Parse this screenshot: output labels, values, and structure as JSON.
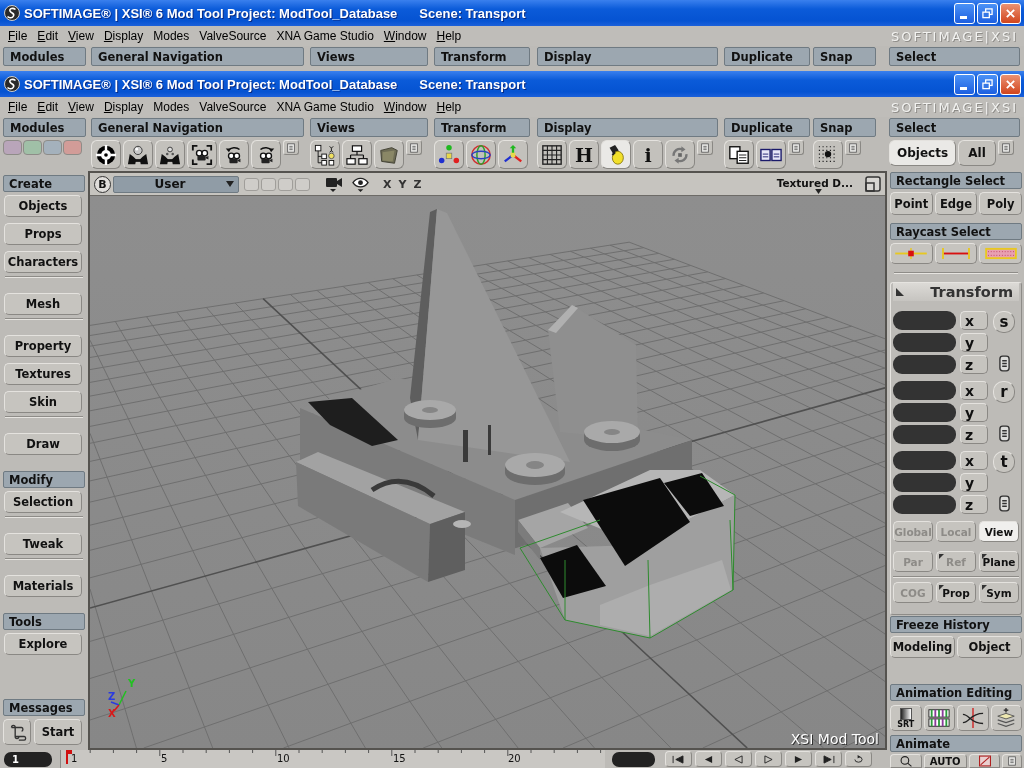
{
  "back_window": {
    "title": "SOFTIMAGE® | XSI® 6 Mod Tool Project: ModTool_Database",
    "scene": "Scene: Transport",
    "menu": [
      {
        "label": "File",
        "mnemonic": true
      },
      {
        "label": "Edit",
        "mnemonic": true
      },
      {
        "label": "View",
        "mnemonic": true
      },
      {
        "label": "Display",
        "mnemonic": true
      },
      {
        "label": "Modes",
        "mnemonic": false
      },
      {
        "label": "ValveSource",
        "mnemonic": false
      },
      {
        "label": "XNA Game Studio",
        "mnemonic": false
      },
      {
        "label": "Window",
        "mnemonic": true
      },
      {
        "label": "Help",
        "mnemonic": true
      }
    ],
    "logo": "SOFTIMAGE|XSI",
    "toolbar": [
      {
        "label": "Modules"
      },
      {
        "label": "General Navigation"
      },
      {
        "label": "Views"
      },
      {
        "label": "Transform"
      },
      {
        "label": "Display"
      },
      {
        "label": "Duplicate"
      },
      {
        "label": "Snap"
      },
      {
        "label": "Select"
      }
    ]
  },
  "window": {
    "title": "SOFTIMAGE® | XSI® 6 Mod Tool Project: ModTool_Database",
    "scene": "Scene: Transport",
    "menu": [
      {
        "label": "File",
        "mnemonic": true
      },
      {
        "label": "Edit",
        "mnemonic": true
      },
      {
        "label": "View",
        "mnemonic": true
      },
      {
        "label": "Display",
        "mnemonic": true
      },
      {
        "label": "Modes",
        "mnemonic": false
      },
      {
        "label": "ValveSource",
        "mnemonic": false
      },
      {
        "label": "XNA Game Studio",
        "mnemonic": false
      },
      {
        "label": "Window",
        "mnemonic": true
      },
      {
        "label": "Help",
        "mnemonic": true
      }
    ],
    "logo": "SOFTIMAGE|XSI",
    "toolbar": [
      {
        "label": "Modules",
        "swatches": [
          {
            "color": "#b9a5ba"
          },
          {
            "color": "#a0c0a7"
          },
          {
            "color": "#a4b1bc"
          },
          {
            "color": "#d29c98"
          }
        ]
      },
      {
        "label": "General Navigation",
        "tools": [
          {
            "kind": "icon",
            "active": false
          },
          {
            "kind": "icon",
            "active": false
          },
          {
            "kind": "icon",
            "active": false
          },
          {
            "kind": "icon",
            "active": false
          },
          {
            "kind": "icon",
            "active": false
          },
          {
            "kind": "icon",
            "active": false
          },
          {
            "kind": "menu",
            "active": false
          }
        ]
      },
      {
        "label": "Views",
        "tools": [
          {
            "kind": "icon",
            "active": false
          },
          {
            "kind": "icon",
            "active": false
          },
          {
            "kind": "icon",
            "active": false
          },
          {
            "kind": "menu",
            "active": false
          }
        ]
      },
      {
        "label": "Transform",
        "tools": [
          {
            "kind": "icon",
            "active": false
          },
          {
            "kind": "icon",
            "active": false
          },
          {
            "kind": "icon",
            "active": false
          }
        ]
      },
      {
        "label": "Display",
        "tools": [
          {
            "kind": "icon",
            "active": false
          },
          {
            "kind": "glyph",
            "label": "H",
            "active": false
          },
          {
            "kind": "icon",
            "active": true
          },
          {
            "kind": "glyph",
            "label": "i",
            "active": false
          },
          {
            "kind": "icon",
            "active": false
          },
          {
            "kind": "menu",
            "active": false
          }
        ]
      },
      {
        "label": "Duplicate",
        "tools": [
          {
            "kind": "icon",
            "active": false
          },
          {
            "kind": "icon",
            "active": false
          },
          {
            "kind": "menu",
            "active": false
          }
        ]
      },
      {
        "label": "Snap",
        "tools": [
          {
            "kind": "icon",
            "active": false
          },
          {
            "kind": "menu",
            "active": false
          }
        ]
      },
      {
        "label": "Select",
        "tools": [
          {
            "kind": "text",
            "label": "Objects",
            "active": true
          },
          {
            "kind": "text",
            "label": "All",
            "active": false
          },
          {
            "kind": "menu",
            "active": false
          }
        ]
      }
    ],
    "create_panel": {
      "sections": [
        {
          "title": "Create",
          "groups": [
            [
              "Objects",
              "Props",
              "Characters"
            ],
            [
              "Mesh"
            ],
            [
              "Property",
              "Textures",
              "Skin"
            ],
            [
              "Draw"
            ]
          ]
        },
        {
          "title": "Modify",
          "groups": [
            [
              "Selection"
            ],
            [
              "Tweak"
            ],
            [
              "Materials"
            ]
          ]
        },
        {
          "title": "Tools",
          "groups": [
            [
              "Explore"
            ]
          ]
        }
      ],
      "messages": {
        "title": "Messages",
        "button": "Start"
      }
    },
    "viewport": {
      "menu_button": "B",
      "camera": "User",
      "axis_toggles": [
        "X",
        "Y",
        "Z"
      ],
      "display_mode": "Textured D...",
      "gizmo_labels": [
        {
          "label": "Y",
          "color": "#22c022"
        },
        {
          "label": "Z",
          "color": "#2a3ae0"
        },
        {
          "label": "X",
          "color": "#d81818"
        }
      ],
      "overlay": "XSI Mod Tool"
    },
    "select_panel": {
      "rectangle_select": {
        "title": "Rectangle Select",
        "buttons": [
          "Point",
          "Edge",
          "Poly"
        ]
      },
      "raycast_select": {
        "title": "Raycast Select"
      },
      "transform": {
        "title": "Transform",
        "groups": [
          {
            "button": "s",
            "axes": [
              "x",
              "y",
              "z"
            ]
          },
          {
            "button": "r",
            "axes": [
              "x",
              "y",
              "z"
            ]
          },
          {
            "button": "t",
            "axes": [
              "x",
              "y",
              "z"
            ]
          }
        ],
        "modes": [
          [
            {
              "label": "Global",
              "disabled": true,
              "selected": false,
              "menu": false
            },
            {
              "label": "Local",
              "disabled": true,
              "selected": false,
              "menu": false
            },
            {
              "label": "View",
              "disabled": false,
              "selected": true,
              "menu": false
            }
          ],
          [
            {
              "label": "Par",
              "disabled": true,
              "selected": false,
              "menu": false
            },
            {
              "label": "Ref",
              "disabled": true,
              "selected": false,
              "menu": true
            },
            {
              "label": "Plane",
              "disabled": false,
              "selected": false,
              "menu": true
            }
          ],
          [
            {
              "label": "COG",
              "disabled": true,
              "selected": false,
              "menu": false
            },
            {
              "label": "Prop",
              "disabled": false,
              "selected": false,
              "menu": true
            },
            {
              "label": "Sym",
              "disabled": false,
              "selected": false,
              "menu": true
            }
          ]
        ]
      },
      "freeze_history": {
        "title": "Freeze History",
        "buttons": [
          "Modeling",
          "Object"
        ]
      },
      "animation_editing": {
        "title": "Animation Editing",
        "tools": [
          {
            "kind": "caption",
            "label": "SRT"
          },
          {
            "kind": "icon"
          },
          {
            "kind": "icon"
          },
          {
            "kind": "icon"
          }
        ]
      },
      "animate": {
        "title": "Animate",
        "tools": [
          {
            "kind": "icon"
          },
          {
            "kind": "text",
            "label": "AUTO"
          },
          {
            "kind": "icon"
          },
          {
            "kind": "menu"
          }
        ]
      }
    },
    "timeline": {
      "frame": "1",
      "ticks": [
        "1",
        "5",
        "10",
        "15",
        "20"
      ]
    }
  }
}
